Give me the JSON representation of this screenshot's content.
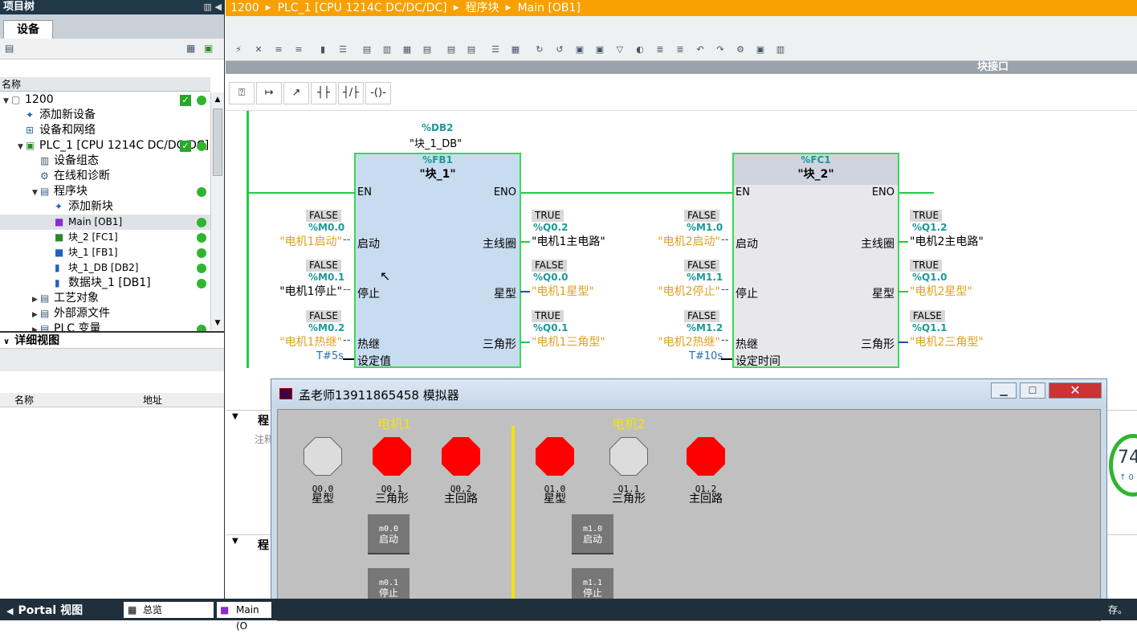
{
  "project_tree": {
    "title": "项目树",
    "tab": "设备",
    "column_name": "名称",
    "items": [
      {
        "label": "1200",
        "indent": 0,
        "check": true,
        "dot": true
      },
      {
        "label": "添加新设备",
        "indent": 1
      },
      {
        "label": "设备和网络",
        "indent": 1
      },
      {
        "label": "PLC_1 [CPU 1214C DC/DC/DC]",
        "indent": 1,
        "check": true,
        "dot": true
      },
      {
        "label": "设备组态",
        "indent": 2
      },
      {
        "label": "在线和诊断",
        "indent": 2
      },
      {
        "label": "程序块",
        "indent": 2,
        "dot": true
      },
      {
        "label": "添加新块",
        "indent": 3
      },
      {
        "label": "Main [OB1]",
        "indent": 3,
        "dot": true,
        "selected": true
      },
      {
        "label": "块_2 [FC1]",
        "indent": 3,
        "dot": true
      },
      {
        "label": "块_1 [FB1]",
        "indent": 3,
        "dot": true
      },
      {
        "label": "块_1_DB [DB2]",
        "indent": 3,
        "dot": true
      },
      {
        "label": "数据块_1 [DB1]",
        "indent": 3,
        "dot": true
      },
      {
        "label": "工艺对象",
        "indent": 2
      },
      {
        "label": "外部源文件",
        "indent": 2
      },
      {
        "label": "PLC 变量",
        "indent": 2,
        "dot": true
      }
    ],
    "detail_title": "详细视图",
    "detail_col_name": "名称",
    "detail_col_addr": "地址"
  },
  "breadcrumb": [
    "1200",
    "PLC_1 [CPU 1214C DC/DC/DC]",
    "程序块",
    "Main [OB1]"
  ],
  "interface_bar": "块接口",
  "network": {
    "fb1": {
      "db_addr": "%DB2",
      "db_name": "\"块_1_DB\"",
      "addr": "%FB1",
      "name": "\"块_1\"",
      "en": "EN",
      "eno": "ENO",
      "in_pins": [
        "启动",
        "停止",
        "热继",
        "设定值"
      ],
      "out_pins": [
        "主线圈",
        "星型",
        "三角形"
      ]
    },
    "fc1": {
      "addr": "%FC1",
      "name": "\"块_2\"",
      "en": "EN",
      "eno": "ENO",
      "in_pins": [
        "启动",
        "停止",
        "热继",
        "设定时间"
      ],
      "out_pins": [
        "主线圈",
        "星型",
        "三角形"
      ]
    },
    "fb1_inputs": [
      {
        "state": "FALSE",
        "addr": "%M0.0",
        "sym": "\"电机1启动\""
      },
      {
        "state": "FALSE",
        "addr": "%M0.1",
        "sym": "\"电机1停止\""
      },
      {
        "state": "FALSE",
        "addr": "%M0.2",
        "sym": "\"电机1热继\""
      }
    ],
    "fb1_const": "T#5s",
    "fb1_outputs": [
      {
        "state": "TRUE",
        "addr": "%Q0.2",
        "sym": "\"电机1主电路\""
      },
      {
        "state": "FALSE",
        "addr": "%Q0.0",
        "sym": "\"电机1星型\""
      },
      {
        "state": "TRUE",
        "addr": "%Q0.1",
        "sym": "\"电机1三角型\""
      }
    ],
    "fc1_inputs": [
      {
        "state": "FALSE",
        "addr": "%M1.0",
        "sym": "\"电机2启动\""
      },
      {
        "state": "FALSE",
        "addr": "%M1.1",
        "sym": "\"电机2停止\""
      },
      {
        "state": "FALSE",
        "addr": "%M1.2",
        "sym": "\"电机2热继\""
      }
    ],
    "fc1_const": "T#10s",
    "fc1_outputs": [
      {
        "state": "TRUE",
        "addr": "%Q1.2",
        "sym": "\"电机2主电路\""
      },
      {
        "state": "TRUE",
        "addr": "%Q1.0",
        "sym": "\"电机2星型\""
      },
      {
        "state": "FALSE",
        "addr": "%Q1.1",
        "sym": "\"电机2三角型\""
      }
    ]
  },
  "sections": {
    "s1": "程",
    "s1_comment": "注释",
    "s2": "程"
  },
  "simulator": {
    "title": "孟老师13911865458 模拟器",
    "motor1": "电机1",
    "motor2": "电机2",
    "lamps": [
      {
        "code": "Q0.0",
        "label": "星型",
        "on": false
      },
      {
        "code": "Q0.1",
        "label": "三角形",
        "on": true
      },
      {
        "code": "Q0.2",
        "label": "主回路",
        "on": true
      },
      {
        "code": "Q1.0",
        "label": "星型",
        "on": true
      },
      {
        "code": "Q1.1",
        "label": "三角形",
        "on": false
      },
      {
        "code": "Q1.2",
        "label": "主回路",
        "on": true
      }
    ],
    "buttons": [
      {
        "code": "m0.0",
        "label": "启动"
      },
      {
        "code": "m0.1",
        "label": "停止"
      },
      {
        "code": "m1.0",
        "label": "启动"
      },
      {
        "code": "m1.1",
        "label": "停止"
      }
    ]
  },
  "right_widget": {
    "value": "74",
    "sub": "↑ 0"
  },
  "taskbar": {
    "portal": "Portal 视图",
    "overview": "总览",
    "main_tab": "Main (O",
    "right_text": "存。"
  },
  "colors": {
    "accent": "#f7a000",
    "wire": "#22cc44",
    "lamp_on": "#ff0000"
  }
}
